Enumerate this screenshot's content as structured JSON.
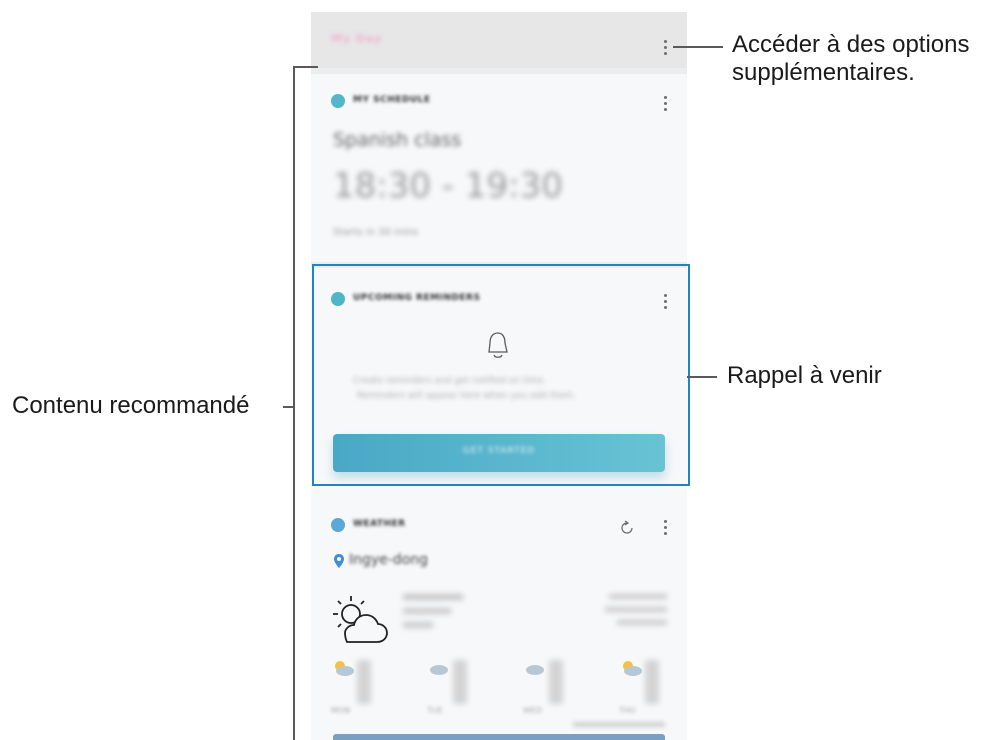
{
  "callouts": {
    "more_options_line1": "Accéder à des options",
    "more_options_line2": "supplémentaires.",
    "upcoming_reminder": "Rappel à venir",
    "recommended_content": "Contenu recommandé"
  },
  "screen": {
    "header_title": "My Day",
    "cards": {
      "schedule": {
        "title": "MY SCHEDULE",
        "event_name": "Spanish class",
        "time_range": "18:30 - 19:30",
        "subtitle": "Starts in 30 mins"
      },
      "reminder": {
        "title": "UPCOMING REMINDERS",
        "body_line1": "Create reminders and get notified on time.",
        "body_line2": "Reminders will appear here when you add them.",
        "button_label": "GET STARTED"
      },
      "weather": {
        "title": "WEATHER",
        "location": "Ingye-dong",
        "forecast_days": [
          "MON",
          "TUE",
          "WED",
          "THU"
        ]
      }
    }
  },
  "colors": {
    "accent": "#1d86c1",
    "button": "#55b4cf",
    "location_pin": "#3d8fd6"
  }
}
